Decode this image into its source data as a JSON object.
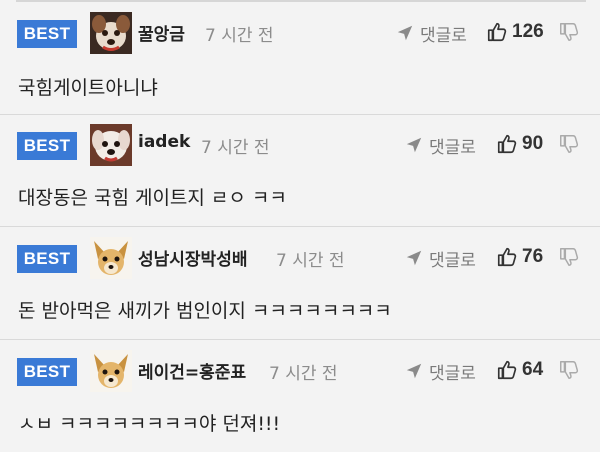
{
  "badge_label": "BEST",
  "reply_label": "댓글로",
  "comments": [
    {
      "nickname": "꿀앙금",
      "time": "7 시간 전",
      "likes": "126",
      "text": "국힘게이트아니냐",
      "avatar": "dog-face-brown"
    },
    {
      "nickname": "iadek",
      "time": "7 시간 전",
      "likes": "90",
      "text": "대장동은 국힘 게이트지 ㄹㅇ ㅋㅋ",
      "avatar": "dog-face-white"
    },
    {
      "nickname": "성남시장박성배",
      "time": "7 시간 전",
      "likes": "76",
      "text": "돈 받아먹은 새끼가 범인이지 ㅋㅋㅋㅋㅋㅋㅋㅋ",
      "avatar": "chihuahua"
    },
    {
      "nickname": "레이건=홍준표",
      "time": "7 시간 전",
      "likes": "64",
      "text": "ㅅㅂ ㅋㅋㅋㅋㅋㅋㅋㅋ야 던져!!!",
      "avatar": "chihuahua"
    }
  ],
  "colors": {
    "badge": "#3a7ad6",
    "background": "#f3f3f3",
    "muted": "#8c8c8c"
  },
  "icons": [
    "paper-plane-icon",
    "thumbs-up-icon",
    "thumbs-down-icon"
  ]
}
